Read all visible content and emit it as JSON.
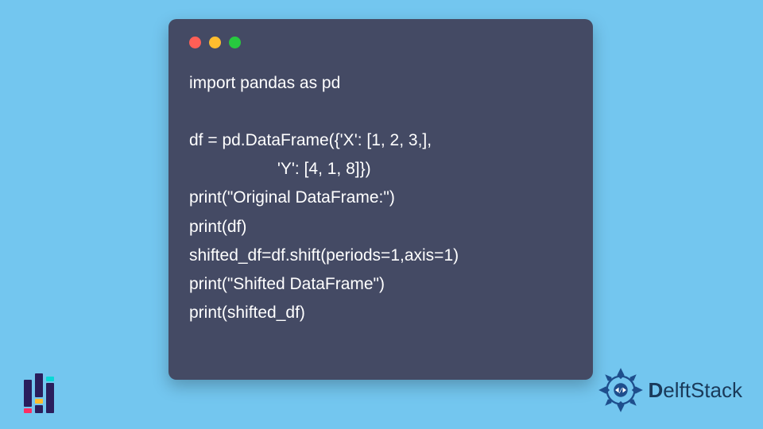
{
  "code": {
    "lines": [
      "import pandas as pd",
      "",
      "df = pd.DataFrame({'X': [1, 2, 3,],",
      "                   'Y': [4, 1, 8]})",
      "print(\"Original DataFrame:\")",
      "print(df)",
      "shifted_df=df.shift(periods=1,axis=1)",
      "print(\"Shifted DataFrame\")",
      "print(shifted_df)"
    ]
  },
  "brand": {
    "name_bold": "D",
    "name_rest": "elftStack"
  },
  "colors": {
    "background": "#73c6ef",
    "card": "#444a64",
    "code_text": "#ffffff",
    "wc_red": "#ff5f56",
    "wc_yellow": "#ffbd2e",
    "wc_green": "#27c93f",
    "brand_primary": "#1e4e8c"
  }
}
